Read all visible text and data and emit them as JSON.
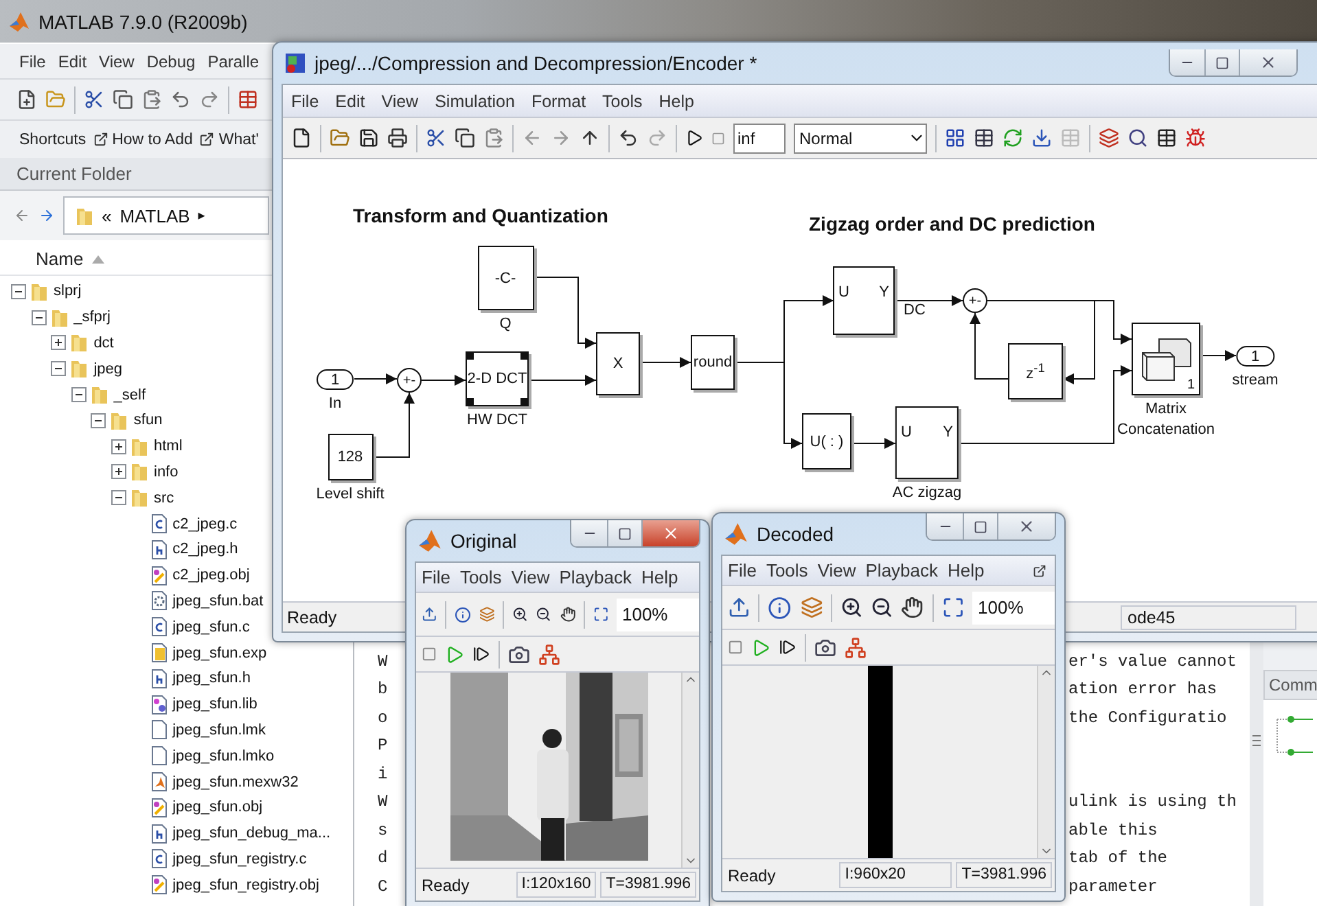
{
  "matlab": {
    "title": "MATLAB  7.9.0 (R2009b)",
    "menu": [
      "File",
      "Edit",
      "View",
      "Debug",
      "Paralle"
    ],
    "shortcuts": [
      {
        "label": "Shortcuts",
        "kind": "plain"
      },
      {
        "label": "How to Add",
        "kind": "link"
      },
      {
        "label": "What'",
        "kind": "link"
      }
    ]
  },
  "current_folder": {
    "title": "Current Folder",
    "path_prefix": "«",
    "path": "MATLAB",
    "path_suffix": "▸",
    "column": "Name",
    "tree": [
      {
        "label": "slprj",
        "kind": "folder",
        "expanded": true,
        "children": [
          {
            "label": "_sfprj",
            "kind": "folder",
            "expanded": true,
            "children": [
              {
                "label": "dct",
                "kind": "folder",
                "expanded": false
              },
              {
                "label": "jpeg",
                "kind": "folder",
                "expanded": true,
                "children": [
                  {
                    "label": "_self",
                    "kind": "folder",
                    "expanded": true,
                    "children": [
                      {
                        "label": "sfun",
                        "kind": "folder",
                        "expanded": true,
                        "children": [
                          {
                            "label": "html",
                            "kind": "folder",
                            "expanded": false
                          },
                          {
                            "label": "info",
                            "kind": "folder",
                            "expanded": false
                          },
                          {
                            "label": "src",
                            "kind": "folder",
                            "expanded": true,
                            "children": [
                              {
                                "label": "c2_jpeg.c",
                                "kind": "c"
                              },
                              {
                                "label": "c2_jpeg.h",
                                "kind": "h"
                              },
                              {
                                "label": "c2_jpeg.obj",
                                "kind": "obj"
                              },
                              {
                                "label": "jpeg_sfun.bat",
                                "kind": "bat"
                              },
                              {
                                "label": "jpeg_sfun.c",
                                "kind": "c"
                              },
                              {
                                "label": "jpeg_sfun.exp",
                                "kind": "exp"
                              },
                              {
                                "label": "jpeg_sfun.h",
                                "kind": "h"
                              },
                              {
                                "label": "jpeg_sfun.lib",
                                "kind": "lib"
                              },
                              {
                                "label": "jpeg_sfun.lmk",
                                "kind": "blank"
                              },
                              {
                                "label": "jpeg_sfun.lmko",
                                "kind": "blank"
                              },
                              {
                                "label": "jpeg_sfun.mexw32",
                                "kind": "mex"
                              },
                              {
                                "label": "jpeg_sfun.obj",
                                "kind": "obj"
                              },
                              {
                                "label": "jpeg_sfun_debug_ma...",
                                "kind": "h"
                              },
                              {
                                "label": "jpeg_sfun_registry.c",
                                "kind": "c"
                              },
                              {
                                "label": "jpeg_sfun_registry.obj",
                                "kind": "obj"
                              }
                            ]
                          }
                        ]
                      }
                    ]
                  }
                ]
              }
            ]
          }
        ]
      }
    ]
  },
  "command_window": {
    "lines": [
      {
        "start": "W",
        "end": "er's value cannot"
      },
      {
        "start": "b",
        "end": "ation error has"
      },
      {
        "start": "o",
        "end": "the Configuratio"
      },
      {
        "start": "P"
      },
      {
        "start": "i"
      },
      {
        "start": "W",
        "end": "ulink is using th"
      },
      {
        "start": "s",
        "end": "able this"
      },
      {
        "start": "d",
        "end": "tab of the"
      },
      {
        "start": "C",
        "end": "parameter"
      }
    ]
  },
  "command_history": {
    "title": "Comm"
  },
  "simulink": {
    "title": "jpeg/.../Compression and Decompression/Encoder *",
    "active": false,
    "menu": [
      "File",
      "Edit",
      "View",
      "Simulation",
      "Format",
      "Tools",
      "Help"
    ],
    "stop_time": "inf",
    "mode": "Normal",
    "status": "Ready",
    "solver": "ode45",
    "diagram": {
      "headings": [
        "Transform and Quantization",
        "Zigzag order and DC prediction"
      ],
      "blocks": [
        {
          "kind": "inport",
          "text": "1",
          "label": "In"
        },
        {
          "kind": "sum",
          "text": "+-"
        },
        {
          "kind": "box",
          "text": "2-D DCT",
          "label": "HW DCT",
          "selected": true
        },
        {
          "kind": "box",
          "text": "128",
          "label": "Level shift",
          "selected": false
        },
        {
          "kind": "box",
          "text": "-C-",
          "label": "Q",
          "selected": false
        },
        {
          "kind": "box",
          "text": "X",
          "selected": false
        },
        {
          "kind": "box",
          "text": "round",
          "selected": false
        },
        {
          "kind": "ports",
          "ports": [
            "U",
            "Y"
          ]
        },
        {
          "kind": "sum",
          "text": "+-"
        },
        {
          "kind": "box",
          "text": "z$^{-1}$",
          "selected": false
        },
        {
          "kind": "concat",
          "text": "1",
          "label": "Matrix Concatenation"
        },
        {
          "kind": "outport",
          "text": "1",
          "label": "stream"
        },
        {
          "kind": "box",
          "text": "U( : )",
          "selected": false
        },
        {
          "kind": "ports",
          "ports": [
            "U",
            "Y"
          ],
          "label": "AC zigzag"
        }
      ],
      "signal_labels": [
        "DC"
      ]
    }
  },
  "viewers": [
    {
      "title": "Original",
      "active": true,
      "menu": [
        "File",
        "Tools",
        "View",
        "Playback",
        "Help"
      ],
      "zoom": "100%",
      "status": "Ready",
      "dimensions": "I:120x160",
      "time": "T=3981.996",
      "kind": "video"
    },
    {
      "title": "Decoded",
      "active": false,
      "menu": [
        "File",
        "Tools",
        "View",
        "Playback",
        "Help"
      ],
      "zoom": "100%",
      "status": "Ready",
      "dimensions": "I:960x20",
      "time": "T=3981.996",
      "kind": "strip"
    }
  ]
}
